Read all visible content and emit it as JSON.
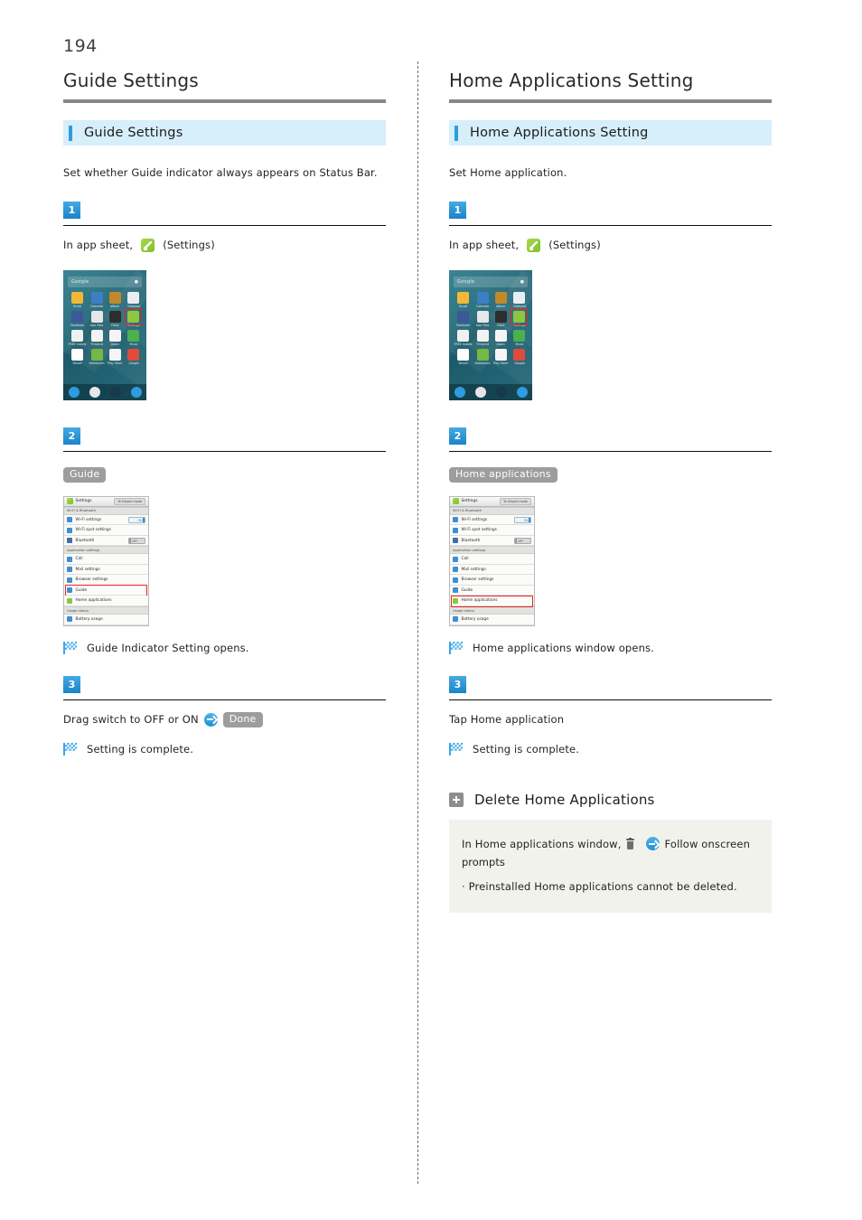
{
  "page": {
    "number": "194"
  },
  "left": {
    "chapter_title": "Guide Settings",
    "section_title": "Guide Settings",
    "intro": "Set whether Guide indicator always appears on Status Bar.",
    "steps": [
      {
        "number": "1",
        "text_before": "In app sheet,",
        "icon": "settings-icon",
        "text_after": "(Settings)"
      },
      {
        "number": "2",
        "chip": "Guide",
        "result": "Guide Indicator Setting opens."
      },
      {
        "number": "3",
        "text_before": "Drag switch to OFF or ON",
        "icon": "arrow-right-icon",
        "chip": "Done",
        "result": "Setting is complete."
      }
    ],
    "home_screen": {
      "search_placeholder": "Google",
      "mic_icon": "microphone-icon",
      "apps": [
        {
          "label": "Gmail",
          "color": "#f2b936"
        },
        {
          "label": "Calendar",
          "color": "#3c7fc4"
        },
        {
          "label": "Album",
          "color": "#c0892c"
        },
        {
          "label": "Notepad",
          "color": "#e9eef2"
        },
        {
          "label": "Facebook",
          "color": "#3b5998"
        },
        {
          "label": "App Pass",
          "color": "#e7e7e7"
        },
        {
          "label": "Clock",
          "color": "#2d2d2d"
        },
        {
          "label": "Settings",
          "color": "#8ec63f",
          "highlight": true
        },
        {
          "label": "FREE mobile",
          "color": "#f0f0f0"
        },
        {
          "label": "Y!transit",
          "color": "#f3f3f3"
        },
        {
          "label": "Japan",
          "color": "#f5f5f5"
        },
        {
          "label": "Music",
          "color": "#4caf50"
        },
        {
          "label": "Yahoo!",
          "color": "#ffffff"
        },
        {
          "label": "Notebooks",
          "color": "#74b944"
        },
        {
          "label": "Play Store",
          "color": "#f5f5f5"
        },
        {
          "label": "Google",
          "color": "#e14b3b"
        }
      ],
      "dock": [
        {
          "name": "phone-icon",
          "color": "#2f9be0"
        },
        {
          "name": "message-icon",
          "color": "#e6e6e6"
        },
        {
          "name": "apps-icon",
          "color": "#17394a"
        },
        {
          "name": "browser-icon",
          "color": "#2f9be0"
        }
      ]
    },
    "settings_list": {
      "title": "Settings",
      "mode_button": "To Simple mode",
      "groups": [
        {
          "name": "Wi-Fi & Bluetooth",
          "rows": [
            {
              "label": "Wi-Fi settings",
              "icon_color": "#3f8fd1",
              "toggle": "ON"
            },
            {
              "label": "Wi-Fi spot settings",
              "icon_color": "#3f8fd1",
              "toggle": null
            },
            {
              "label": "Bluetooth",
              "icon_color": "#3f6fa8",
              "toggle": "OFF"
            }
          ]
        },
        {
          "name": "Application settings",
          "rows": [
            {
              "label": "Call",
              "icon_color": "#3f8fd1",
              "toggle": null
            },
            {
              "label": "Mail settings",
              "icon_color": "#3f8fd1",
              "toggle": null
            },
            {
              "label": "Browser settings",
              "icon_color": "#3f8fd1",
              "toggle": null
            },
            {
              "label": "Guide",
              "icon_color": "#3f8fd1",
              "toggle": null,
              "highlight": true
            },
            {
              "label": "Home applications",
              "icon_color": "#8ec63f",
              "toggle": null
            }
          ]
        },
        {
          "name": "Usage status",
          "rows": [
            {
              "label": "Battery usage",
              "icon_color": "#3f8fd1",
              "toggle": null
            }
          ]
        }
      ]
    }
  },
  "right": {
    "chapter_title": "Home Applications Setting",
    "section_title": "Home Applications Setting",
    "intro": "Set Home application.",
    "steps": [
      {
        "number": "1",
        "text_before": "In app sheet,",
        "icon": "settings-icon",
        "text_after": "(Settings)"
      },
      {
        "number": "2",
        "chip": "Home applications",
        "result": "Home applications window opens."
      },
      {
        "number": "3",
        "text_before": "Tap Home application",
        "result": "Setting is complete."
      }
    ],
    "tip": {
      "heading": "Delete Home Applications",
      "line_before": "In Home applications window,",
      "trash_icon": "trash-icon",
      "arrow_icon": "arrow-right-icon",
      "line_after": "Follow onscreen",
      "line_cont": "prompts",
      "note": "· Preinstalled Home applications cannot be deleted."
    },
    "home_screen": {
      "search_placeholder": "Google",
      "mic_icon": "microphone-icon"
    },
    "settings_list": {
      "title": "Settings",
      "mode_button": "To Simple mode",
      "groups": [
        {
          "name": "Wi-Fi & Bluetooth",
          "rows": [
            {
              "label": "Wi-Fi settings",
              "icon_color": "#3f8fd1",
              "toggle": "ON"
            },
            {
              "label": "Wi-Fi spot settings",
              "icon_color": "#3f8fd1",
              "toggle": null
            },
            {
              "label": "Bluetooth",
              "icon_color": "#3f6fa8",
              "toggle": "OFF"
            }
          ]
        },
        {
          "name": "Application settings",
          "rows": [
            {
              "label": "Call",
              "icon_color": "#3f8fd1",
              "toggle": null
            },
            {
              "label": "Mail settings",
              "icon_color": "#3f8fd1",
              "toggle": null
            },
            {
              "label": "Browser settings",
              "icon_color": "#3f8fd1",
              "toggle": null
            },
            {
              "label": "Guide",
              "icon_color": "#3f8fd1",
              "toggle": null
            },
            {
              "label": "Home applications",
              "icon_color": "#8ec63f",
              "toggle": null,
              "highlight": true
            }
          ]
        },
        {
          "name": "Usage status",
          "rows": [
            {
              "label": "Battery usage",
              "icon_color": "#3f8fd1",
              "toggle": null
            }
          ]
        }
      ]
    }
  }
}
